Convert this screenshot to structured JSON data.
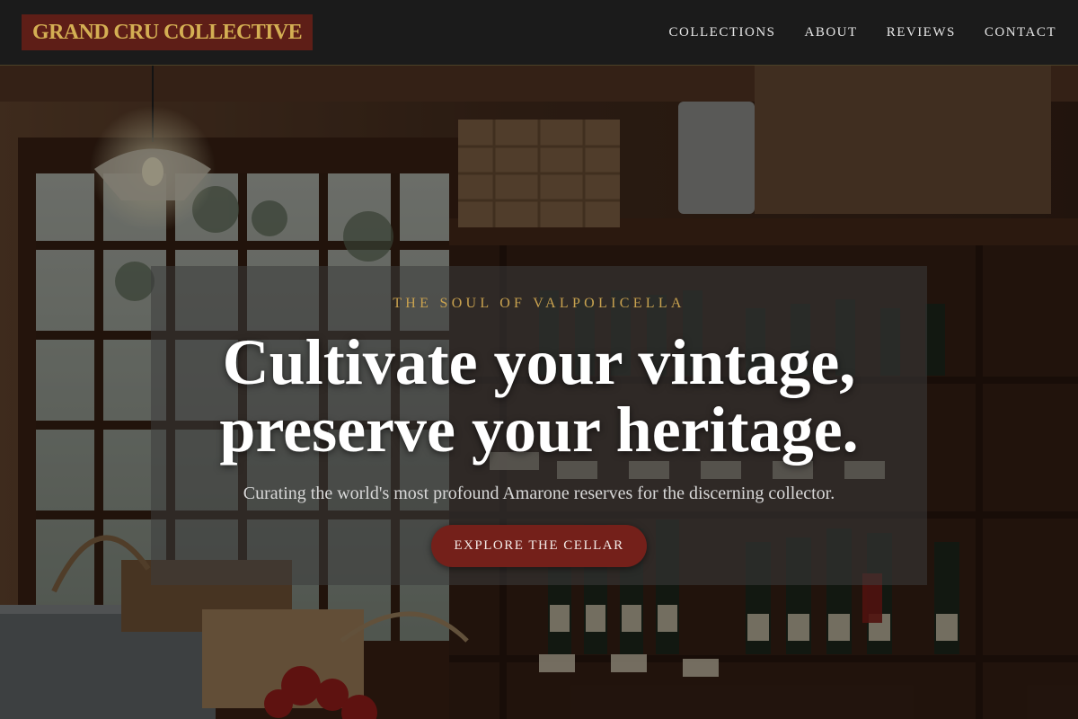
{
  "brand": {
    "name": "GRAND CRU COLLECTIVE"
  },
  "nav": {
    "items": [
      {
        "label": "COLLECTIONS"
      },
      {
        "label": "ABOUT"
      },
      {
        "label": "REVIEWS"
      },
      {
        "label": "CONTACT"
      }
    ]
  },
  "hero": {
    "eyebrow": "THE SOUL OF VALPOLICELLA",
    "headline_line1": "Cultivate your vintage,",
    "headline_line2": "preserve your heritage.",
    "subheadline": "Curating the world's most profound Amarone reserves for the discerning collector.",
    "cta_label": "EXPLORE THE CELLAR"
  },
  "colors": {
    "brand_gold": "#d4af53",
    "brand_burgundy": "#5e1e17",
    "cta_burgundy": "#74201a",
    "header_bg": "#1b1b1b"
  }
}
